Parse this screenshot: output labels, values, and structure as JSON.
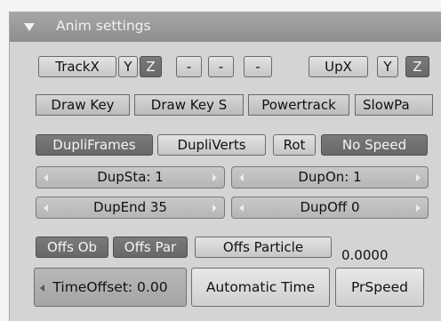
{
  "panel": {
    "title": "Anim settings"
  },
  "row1": {
    "trackx": "TrackX",
    "y": "Y",
    "z": "Z",
    "m1": "-",
    "m2": "-",
    "m3": "-",
    "upx": "UpX",
    "upy": "Y",
    "upz": "Z"
  },
  "row2": {
    "draw_key": "Draw Key",
    "draw_key_sel": "Draw Key S",
    "powertrack": "Powertrack",
    "slowpar": "SlowPa"
  },
  "row3": {
    "dupliframes": "DupliFrames",
    "dupliverts": "DupliVerts",
    "rot": "Rot",
    "no_speed": "No Speed"
  },
  "fields": {
    "dupsta": "DupSta: 1",
    "dupon": "DupOn: 1",
    "dupend": "DupEnd 35",
    "dupoff": "DupOff 0"
  },
  "offs": {
    "offs_ob": "Offs Ob",
    "offs_par": "Offs Par",
    "offs_particle": "Offs Particle",
    "value": "0.0000"
  },
  "bottom": {
    "time_offset": "TimeOffset: 0.00",
    "automatic_time": "Automatic Time",
    "prspeed": "PrSpeed"
  }
}
